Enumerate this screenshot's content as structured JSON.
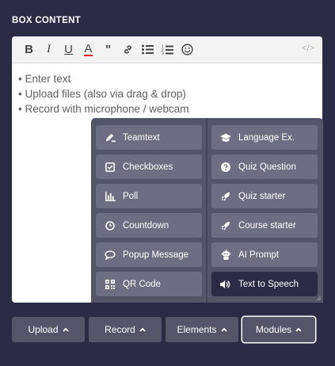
{
  "section": {
    "title": "BOX CONTENT"
  },
  "toolbar": {
    "items": [
      {
        "icon": "bold-icon",
        "glyph": "B"
      },
      {
        "icon": "italic-icon",
        "glyph": "I"
      },
      {
        "icon": "underline-icon",
        "glyph": "U"
      },
      {
        "icon": "text-color-icon",
        "glyph": "A"
      },
      {
        "icon": "quote-icon",
        "glyph": "\""
      },
      {
        "icon": "link-icon"
      },
      {
        "icon": "bullet-list-icon"
      },
      {
        "icon": "numbered-list-icon"
      },
      {
        "icon": "emoji-icon"
      }
    ],
    "code_glyph": "</>",
    "text_color_accent": "#e02020"
  },
  "editor": {
    "lines": [
      "• Enter text",
      "• Upload files (also via drag & drop)",
      "• Record with microphone / webcam"
    ]
  },
  "modules_menu": {
    "left": [
      {
        "label": "Teamtext",
        "icon": "pencil-icon"
      },
      {
        "label": "Checkboxes",
        "icon": "checkbox-icon"
      },
      {
        "label": "Poll",
        "icon": "bar-chart-icon"
      },
      {
        "label": "Countdown",
        "icon": "clock-icon"
      },
      {
        "label": "Popup Message",
        "icon": "speech-bubble-icon"
      },
      {
        "label": "QR Code",
        "icon": "qr-code-icon"
      }
    ],
    "right": [
      {
        "label": "Language Ex.",
        "icon": "graduation-cap-icon"
      },
      {
        "label": "Quiz Question",
        "icon": "question-circle-icon"
      },
      {
        "label": "Quiz starter",
        "icon": "rocket-icon"
      },
      {
        "label": "Course starter",
        "icon": "rocket-icon"
      },
      {
        "label": "AI Prompt",
        "icon": "robot-icon"
      },
      {
        "label": "Text to Speech",
        "icon": "speaker-icon",
        "active": true
      }
    ]
  },
  "bottom": {
    "upload": "Upload",
    "record": "Record",
    "elements": "Elements",
    "modules": "Modules"
  },
  "colors": {
    "background": "#2b2b45",
    "button": "#55556a",
    "menu_item": "#6e6e82",
    "active_item": "#2b2b45"
  }
}
